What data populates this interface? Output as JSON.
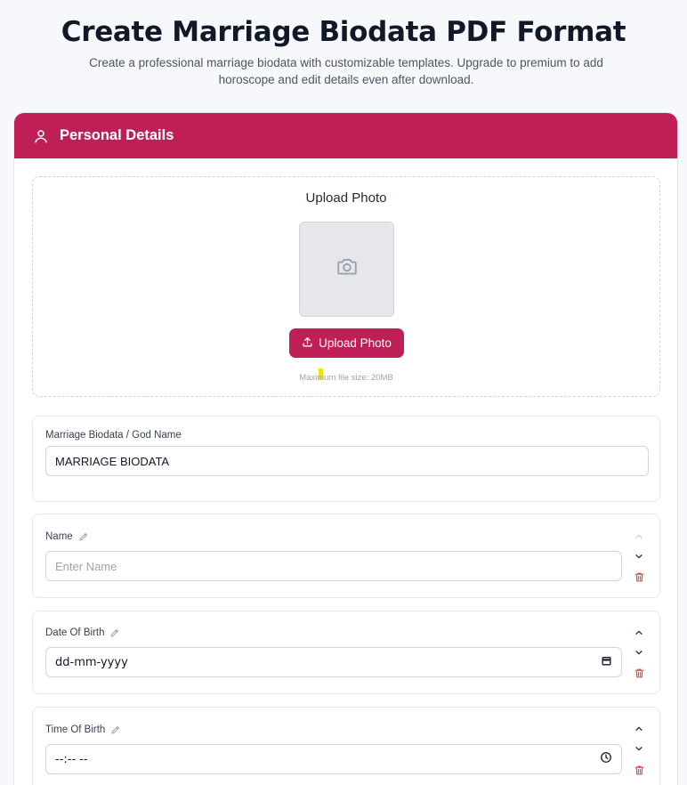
{
  "page": {
    "title": "Create Marriage Biodata PDF Format",
    "subtitle": "Create a professional marriage biodata with customizable templates. Upgrade to premium to add horoscope and edit details even after download."
  },
  "section": {
    "title": "Personal Details",
    "icon": "user-icon"
  },
  "upload": {
    "heading": "Upload Photo",
    "button_label": "Upload Photo",
    "max_size_text": "Maximum file size: 20MB",
    "placeholder_icon": "camera-icon"
  },
  "fields": {
    "god_name": {
      "label": "Marriage Biodata / God Name",
      "value": "MARRIAGE BIODATA"
    },
    "name": {
      "label": "Name",
      "placeholder": "Enter Name",
      "value": ""
    },
    "dob": {
      "label": "Date Of Birth",
      "value": "dd-mm-yyyy"
    },
    "tob": {
      "label": "Time Of Birth",
      "value": "--:-- --"
    }
  },
  "colors": {
    "accent": "#be1f57",
    "delete": "#e0403f"
  }
}
